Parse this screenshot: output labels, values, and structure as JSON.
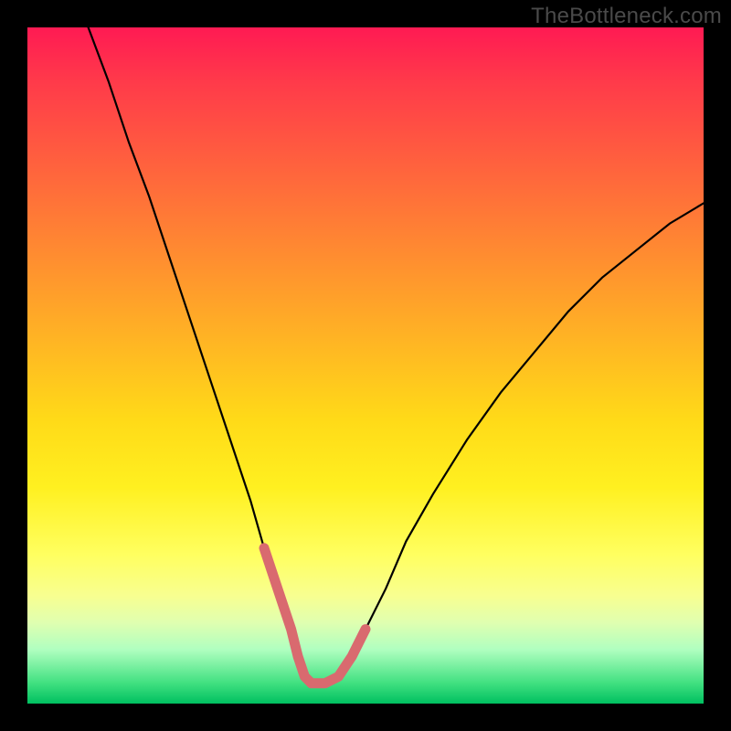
{
  "watermark": "TheBottleneck.com",
  "colors": {
    "frame": "#000000",
    "curve": "#000000",
    "highlight": "#d96a6f",
    "gradient_top": "#ff1a53",
    "gradient_bottom": "#00c060"
  },
  "chart_data": {
    "type": "line",
    "title": "",
    "xlabel": "",
    "ylabel": "",
    "xlim": [
      0,
      100
    ],
    "ylim": [
      0,
      100
    ],
    "note": "Values estimated from pixel positions; axes unlabeled in source image. y represents vertical position (0=bottom,100=top).",
    "series": [
      {
        "name": "main-curve",
        "x": [
          9,
          12,
          15,
          18,
          21,
          24,
          27,
          30,
          33,
          35,
          37,
          39,
          40,
          41,
          42,
          44,
          46,
          48,
          50,
          53,
          56,
          60,
          65,
          70,
          75,
          80,
          85,
          90,
          95,
          100
        ],
        "y": [
          100,
          92,
          83,
          75,
          66,
          57,
          48,
          39,
          30,
          23,
          17,
          11,
          7,
          4,
          3,
          3,
          4,
          7,
          11,
          17,
          24,
          31,
          39,
          46,
          52,
          58,
          63,
          67,
          71,
          74
        ]
      },
      {
        "name": "highlight-segment",
        "x": [
          35,
          37,
          39,
          40,
          41,
          42,
          44,
          46,
          48,
          50
        ],
        "y": [
          23,
          17,
          11,
          7,
          4,
          3,
          3,
          4,
          7,
          11
        ]
      }
    ]
  }
}
